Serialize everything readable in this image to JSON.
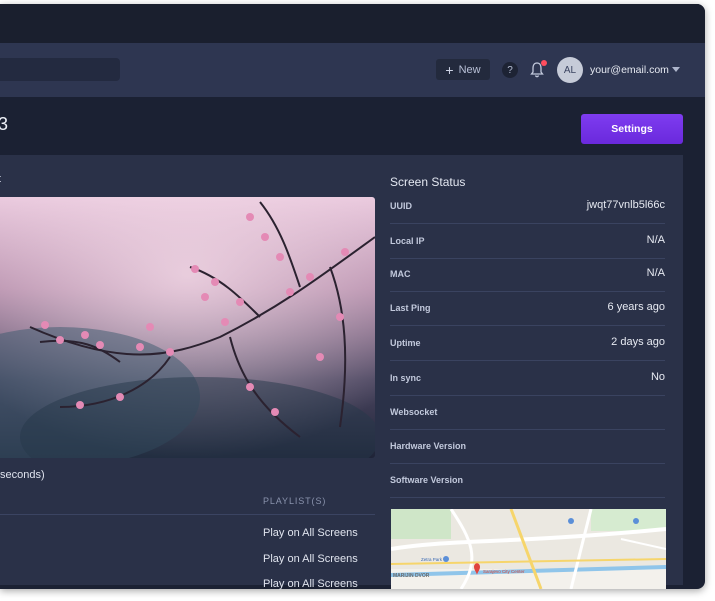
{
  "nav": {
    "new_label": "New",
    "help_label": "?",
    "avatar_initials": "AL",
    "user_email": "your@email.com"
  },
  "page": {
    "title_fragment": "3",
    "settings_label": "Settings",
    "panel_title_fragment": "t"
  },
  "preview": {
    "duration_text": "seconds)"
  },
  "playlist": {
    "header": "PLAYLIST(S)",
    "rows": [
      "Play on All Screens",
      "Play on All Screens",
      "Play on All Screens"
    ]
  },
  "status": {
    "title": "Screen Status",
    "rows": [
      {
        "label": "UUID",
        "value": "jwqt77vnlb5l66c"
      },
      {
        "label": "Local IP",
        "value": "N/A"
      },
      {
        "label": "MAC",
        "value": "N/A"
      },
      {
        "label": "Last Ping",
        "value": "6 years ago"
      },
      {
        "label": "Uptime",
        "value": "2 days ago"
      },
      {
        "label": "In sync",
        "value": "No"
      },
      {
        "label": "Websocket",
        "value": ""
      },
      {
        "label": "Hardware Version",
        "value": ""
      },
      {
        "label": "Software Version",
        "value": ""
      }
    ]
  },
  "map": {
    "labels": [
      "MARIJIN DVOR",
      "Sarajevo City Center",
      "Zetra Park"
    ]
  },
  "colors": {
    "accent": "#7437e8",
    "notification": "#ff4d5e",
    "background": "#1b2133",
    "panel": "#2a3148"
  }
}
